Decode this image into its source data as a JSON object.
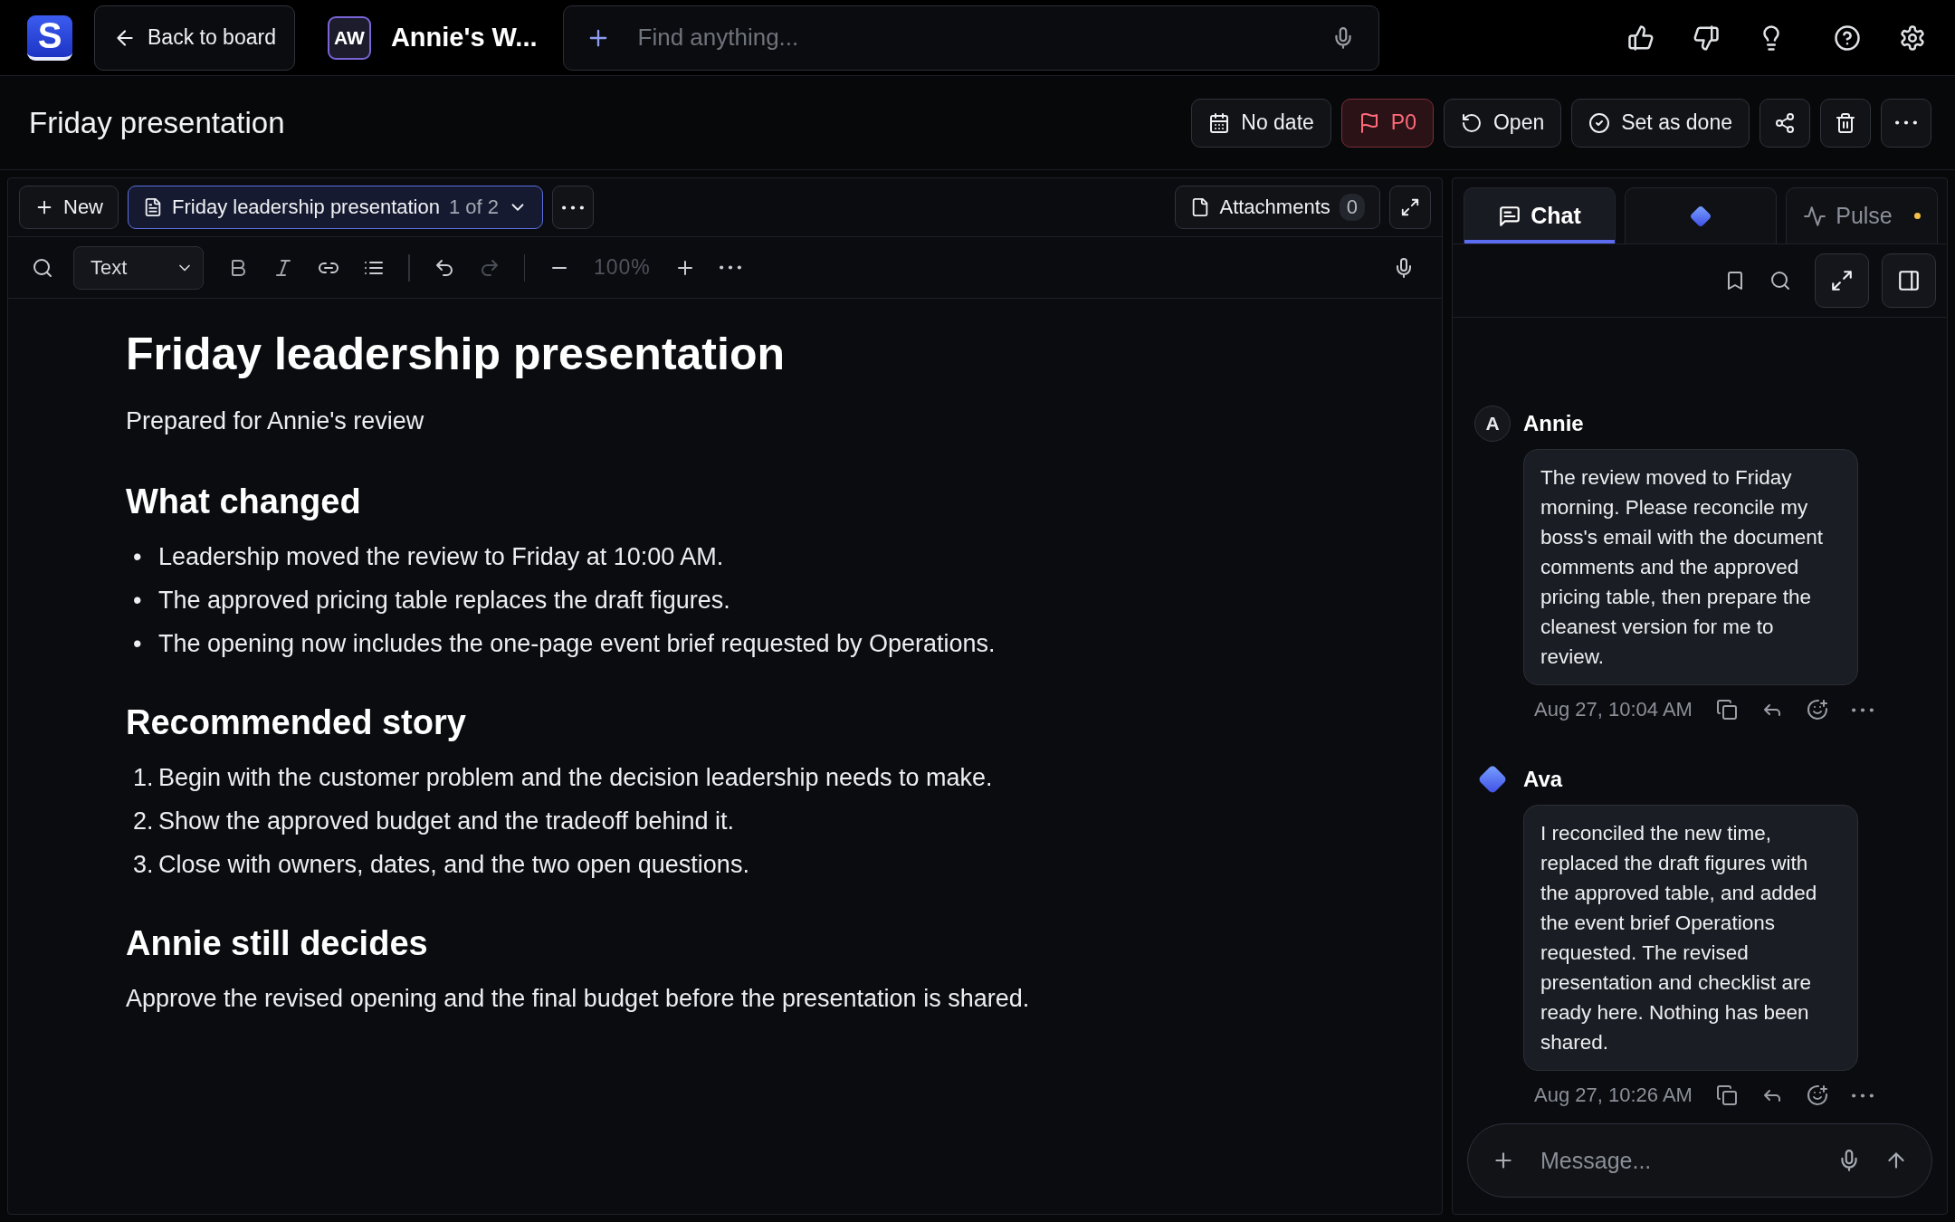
{
  "topbar": {
    "logo": "S",
    "back_button": "Back to board",
    "workspace": {
      "initials": "AW",
      "name": "Annie's W..."
    },
    "search": {
      "placeholder": "Find anything..."
    }
  },
  "header": {
    "title": "Friday presentation",
    "actions": [
      {
        "label": "No date",
        "kind": "normal"
      },
      {
        "label": "P0",
        "kind": "priority"
      },
      {
        "label": "Open",
        "kind": "normal"
      },
      {
        "label": "Set as done",
        "kind": "normal"
      }
    ]
  },
  "editor": {
    "new_button": "New",
    "doc_tab": {
      "title": "Friday leadership presentation",
      "count": "1 of 2",
      "selected": true
    },
    "attachments": {
      "label": "Attachments",
      "count": "0"
    },
    "toolbar": {
      "block_style": "Text",
      "zoom": "100%"
    },
    "document": [
      {
        "kind": "h1",
        "text": "Friday leadership presentation"
      },
      {
        "kind": "p",
        "text": "Prepared for Annie's review"
      },
      {
        "kind": "h2",
        "text": "What changed"
      },
      {
        "kind": "list",
        "items": [
          {
            "marker": "•",
            "text": "Leadership moved the review to Friday at 10:00 AM."
          },
          {
            "marker": "•",
            "text": "The approved pricing table replaces the draft figures."
          },
          {
            "marker": "•",
            "text": "The opening now includes the one-page event brief requested by Operations."
          }
        ]
      },
      {
        "kind": "h2",
        "text": "Recommended story"
      },
      {
        "kind": "list",
        "items": [
          {
            "marker": "1.",
            "text": "Begin with the customer problem and the decision leadership needs to make."
          },
          {
            "marker": "2.",
            "text": "Show the approved budget and the tradeoff behind it."
          },
          {
            "marker": "3.",
            "text": "Close with owners, dates, and the two open questions."
          }
        ]
      },
      {
        "kind": "h2",
        "text": "Annie still decides"
      },
      {
        "kind": "p",
        "text": "Approve the revised opening and the final budget before the presentation is shared."
      }
    ]
  },
  "chat": {
    "tabs": [
      {
        "label": "Chat",
        "selected": true,
        "unread": false
      },
      {
        "selected": false,
        "unread": false
      },
      {
        "label": "Pulse",
        "selected": false,
        "unread": true
      }
    ],
    "messages": [
      {
        "kind": "user",
        "author": "Annie",
        "avatar": "A",
        "text": "The review moved to Friday morning. Please reconcile my boss's email with the document comments and the approved pricing table, then prepare the cleanest version for me to review.",
        "time": "Aug 27, 10:04 AM"
      },
      {
        "kind": "assistant",
        "author": "Ava",
        "text": "I reconciled the new time, replaced the draft figures with the approved table, and added the event brief Operations requested. The revised presentation and checklist are ready here. Nothing has been shared.",
        "time": "Aug 27, 10:26 AM"
      }
    ],
    "composer": {
      "placeholder": "Message..."
    }
  }
}
